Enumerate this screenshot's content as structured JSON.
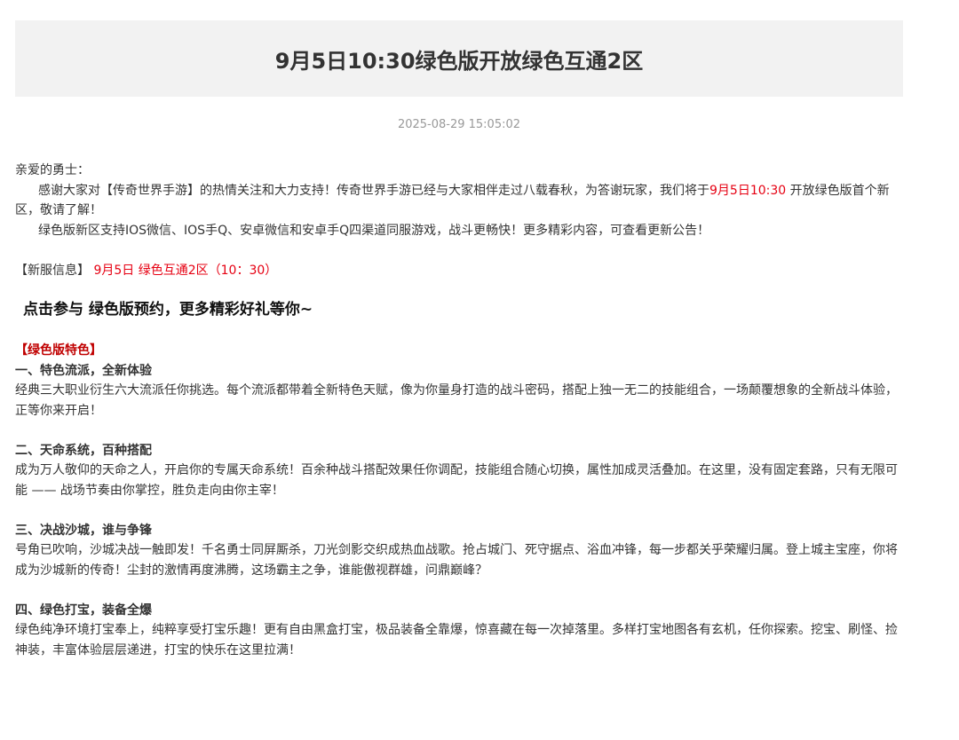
{
  "article": {
    "title": "9月5日10:30绿色版开放绿色互通2区",
    "date": "2025-08-29 15:05:02",
    "greeting": "亲爱的勇士：",
    "intro": {
      "before": "感谢大家对【传奇世界手游】的热情关注和大力支持！传奇世界手游已经与大家相伴走过八载春秋，为答谢玩家，我们将于",
      "highlight": "9月5日10:30",
      "after": " 开放绿色版首个新区，敬请了解！"
    },
    "channels": "绿色版新区支持IOS微信、IOS手Q、安卓微信和安卓手Q四渠道同服游戏，战斗更畅快！更多精彩内容，可查看更新公告！",
    "server_info": {
      "label": "【新服信息】",
      "value": "9月5日  绿色互通2区（10：30）"
    },
    "promo": {
      "before": "点击参与 ",
      "link": "绿色版预约",
      "after": "，更多精彩好礼等你~"
    },
    "features_heading": "【绿色版特色】",
    "features": [
      {
        "title": "一、特色流派，全新体验",
        "text": "经典三大职业衍生六大流派任你挑选。每个流派都带着全新特色天赋，像为你量身打造的战斗密码，搭配上独一无二的技能组合，一场颠覆想象的全新战斗体验，正等你来开启！"
      },
      {
        "title": "二、天命系统，百种搭配",
        "text": "成为万人敬仰的天命之人，开启你的专属天命系统！百余种战斗搭配效果任你调配，技能组合随心切换，属性加成灵活叠加。在这里，没有固定套路，只有无限可能 —— 战场节奏由你掌控，胜负走向由你主宰！"
      },
      {
        "title": "三、决战沙城，谁与争锋",
        "text": "号角已吹响，沙城决战一触即发！千名勇士同屏厮杀，刀光剑影交织成热血战歌。抢占城门、死守据点、浴血冲锋，每一步都关乎荣耀归属。登上城主宝座，你将成为沙城新的传奇！尘封的激情再度沸腾，这场霸主之争，谁能傲视群雄，问鼎巅峰？"
      },
      {
        "title": "四、绿色打宝，装备全爆",
        "text": "绿色纯净环境打宝奉上，纯粹享受打宝乐趣！更有自由黑盒打宝，极品装备全靠爆，惊喜藏在每一次掉落里。多样打宝地图各有玄机，任你探索。挖宝、刷怪、捡神装，丰富体验层层递进，打宝的快乐在这里拉满！"
      }
    ]
  }
}
